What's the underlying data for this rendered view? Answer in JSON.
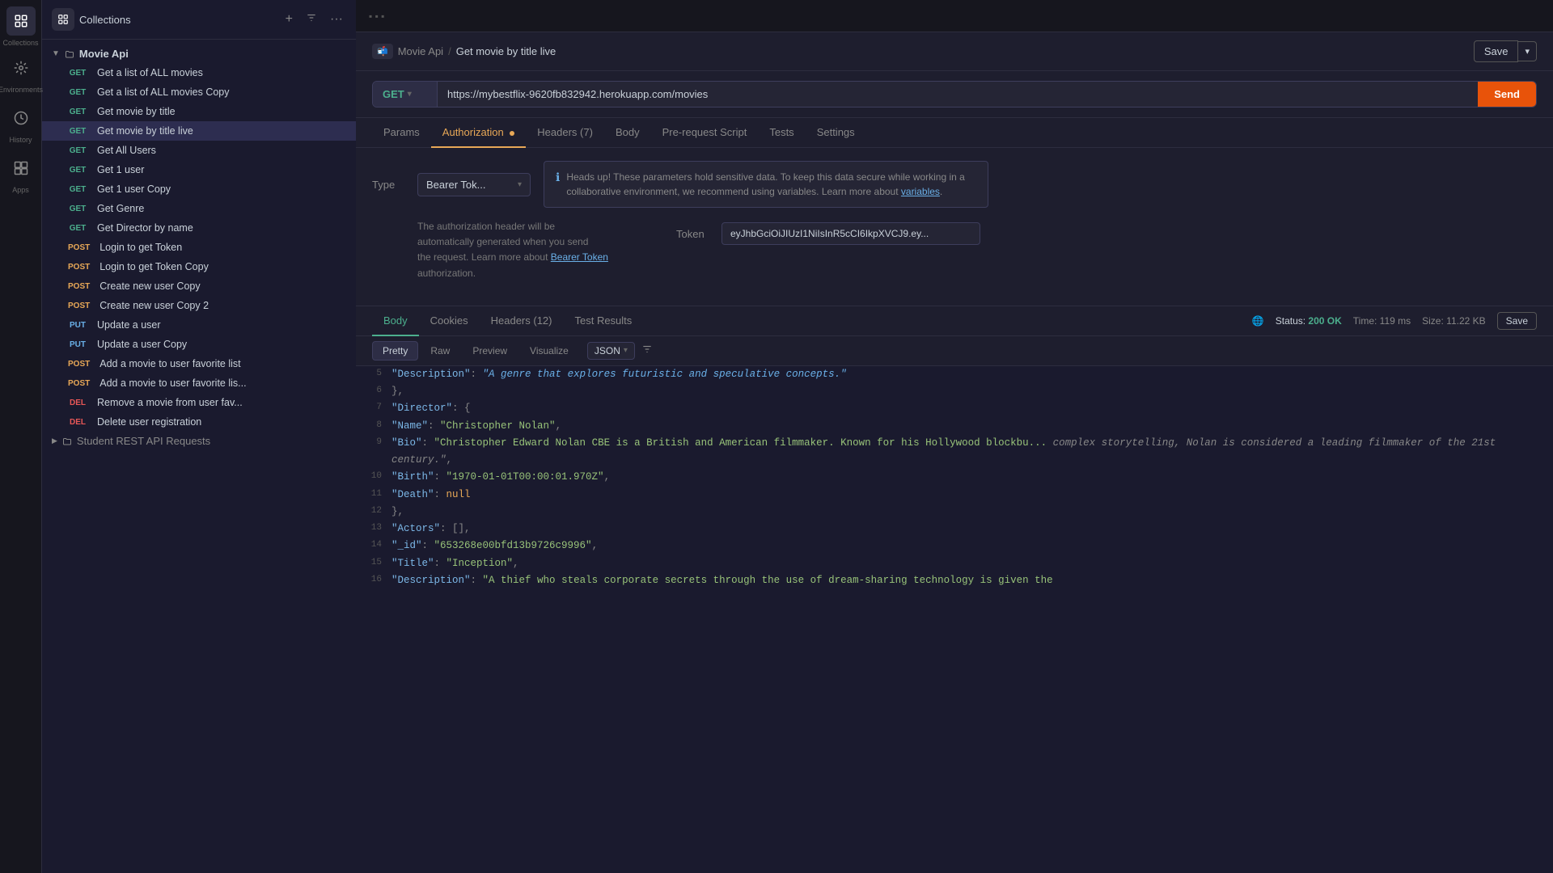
{
  "sidebar": {
    "collections_label": "Collections",
    "environments_label": "Environments",
    "history_label": "History",
    "apps_label": "Apps",
    "add_tooltip": "New",
    "filter_tooltip": "Filter",
    "more_tooltip": "More",
    "collection_name": "Movie Api",
    "items": [
      {
        "id": "get-all-movies",
        "method": "GET",
        "label": "Get a list of ALL movies",
        "active": false
      },
      {
        "id": "get-all-movies-copy",
        "method": "GET",
        "label": "Get a list of ALL movies Copy",
        "active": false
      },
      {
        "id": "get-movie-by-title",
        "method": "GET",
        "label": "Get movie by title",
        "active": false
      },
      {
        "id": "get-movie-by-title-live",
        "method": "GET",
        "label": "Get movie by title live",
        "active": true
      },
      {
        "id": "get-all-users",
        "method": "GET",
        "label": "Get All Users",
        "active": false
      },
      {
        "id": "get-1-user",
        "method": "GET",
        "label": "Get 1 user",
        "active": false
      },
      {
        "id": "get-1-user-copy",
        "method": "GET",
        "label": "Get 1 user Copy",
        "active": false
      },
      {
        "id": "get-genre",
        "method": "GET",
        "label": "Get Genre",
        "active": false
      },
      {
        "id": "get-director-by-name",
        "method": "GET",
        "label": "Get Director by name",
        "active": false
      },
      {
        "id": "login-to-get-token",
        "method": "POST",
        "label": "Login to get Token",
        "active": false
      },
      {
        "id": "login-to-get-token-copy",
        "method": "POST",
        "label": "Login to get Token Copy",
        "active": false
      },
      {
        "id": "create-new-user-copy",
        "method": "POST",
        "label": "Create new user Copy",
        "active": false
      },
      {
        "id": "create-new-user-copy-2",
        "method": "POST",
        "label": "Create new user Copy 2",
        "active": false
      },
      {
        "id": "update-a-user",
        "method": "PUT",
        "label": "Update a user",
        "active": false
      },
      {
        "id": "update-a-user-copy",
        "method": "PUT",
        "label": "Update a user Copy",
        "active": false
      },
      {
        "id": "add-movie-to-favorites",
        "method": "POST",
        "label": "Add a movie to user favorite list",
        "active": false
      },
      {
        "id": "add-movie-to-favorites-2",
        "method": "POST",
        "label": "Add a movie to user favorite lis...",
        "active": false
      },
      {
        "id": "remove-movie-from-favorites",
        "method": "DEL",
        "label": "Remove a movie from user fav...",
        "active": false
      },
      {
        "id": "delete-user-registration",
        "method": "DEL",
        "label": "Delete user registration",
        "active": false
      }
    ],
    "student_collection": "Student REST API Requests"
  },
  "request": {
    "breadcrumb_icon": "📬",
    "breadcrumb_collection": "Movie Api",
    "breadcrumb_separator": "/",
    "breadcrumb_title": "Get movie by title live",
    "save_label": "Save",
    "method": "GET",
    "url": "https://mybestflix-9620fb832942.herokuapp.com/movies",
    "tabs": [
      "Params",
      "Authorization",
      "Headers (7)",
      "Body",
      "Pre-request Script",
      "Tests",
      "Settings"
    ],
    "active_tab": "Authorization"
  },
  "auth": {
    "type_label": "Type",
    "type_value": "Bearer Tok...",
    "info_text": "Heads up! These parameters hold sensitive data. To keep this data secure while working in a collaborative environment, we recommend using variables. Learn more about",
    "info_link": "variables",
    "description_line1": "The authorization header will be",
    "description_line2": "automatically generated when you send",
    "description_line3": "the request. Learn more about",
    "bearer_link": "Bearer Token",
    "description_suffix": "authorization.",
    "token_label": "Token",
    "token_value": "eyJhbGciOiJIUzI1NiIsInR5cCI6IkpXVCJ9.ey..."
  },
  "response": {
    "tabs": [
      "Body",
      "Cookies",
      "Headers (12)",
      "Test Results"
    ],
    "active_tab": "Body",
    "status": "200 OK",
    "time": "119 ms",
    "size": "11.22 KB",
    "save_label": "Save",
    "format_tabs": [
      "Pretty",
      "Raw",
      "Preview",
      "Visualize"
    ],
    "active_format": "Pretty",
    "format_type": "JSON",
    "lines": [
      {
        "num": 5,
        "content": "\"Description\": \"A genre that explores futuristic and speculative concepts\"",
        "type": "comment"
      },
      {
        "num": 6,
        "content": "    },"
      },
      {
        "num": 7,
        "content": "    \"Director\": {",
        "key": "Director"
      },
      {
        "num": 8,
        "content": "        \"Name\": \"Christopher Nolan\",",
        "key": "Name",
        "value": "Christopher Nolan"
      },
      {
        "num": 9,
        "content": "        \"Bio\": \"Christopher Edward Nolan CBE is a British and American filmmaker. Known for his Hollywood blockbu...",
        "key": "Bio",
        "value": "Christopher Edward Nolan CBE is a British and American filmmaker. Known for his Hollywood blockbu"
      },
      {
        "num": 10,
        "content": "        \"Birth\": \"1970-01-01T00:00:01.970Z\",",
        "key": "Birth",
        "value": "1970-01-01T00:00:01.970Z"
      },
      {
        "num": 11,
        "content": "        \"Death\": null",
        "key": "Death",
        "null_value": true
      },
      {
        "num": 12,
        "content": "    },"
      },
      {
        "num": 13,
        "content": "    \"Actors\": [],"
      },
      {
        "num": 14,
        "content": "    \"_id\": \"653268e00bfd13b9726c9996\",",
        "key": "_id",
        "value": "653268e00bfd13b9726c9996"
      },
      {
        "num": 15,
        "content": "    \"Title\": \"Inception\",",
        "key": "Title",
        "value": "Inception"
      },
      {
        "num": 16,
        "content": "    \"Description\": \"A thief who steals corporate secrets through the use of dream-sharing technology is given the",
        "key": "Description",
        "value": "A thief who steals corporate secrets through the use of dream-sharing technology is given the"
      }
    ]
  }
}
